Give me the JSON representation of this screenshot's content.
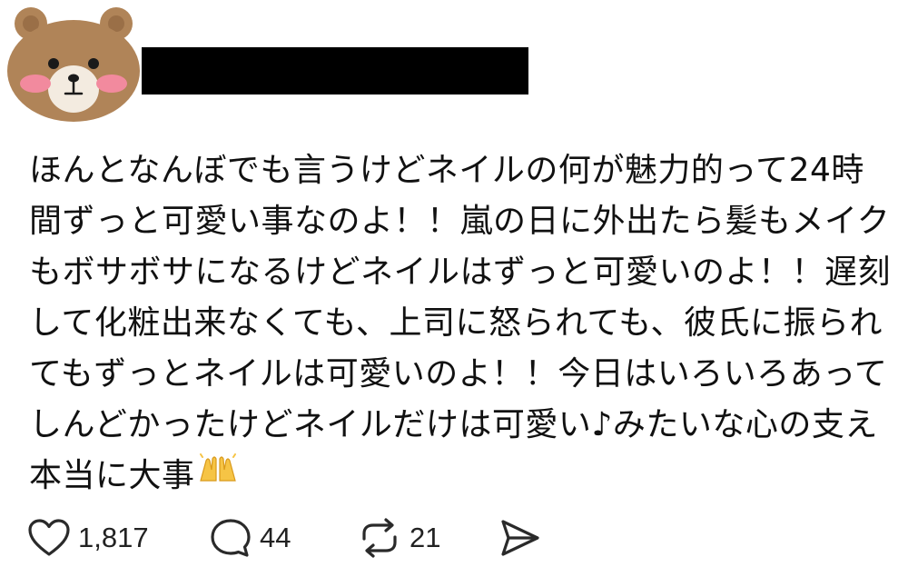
{
  "post": {
    "avatar_icon": "bear-avatar-icon",
    "text_lines": [
      "ほんとなんぼでも言うけどネイルの何が魅力的って24時",
      "間ずっと可愛い事なのよ！！嵐の日に外出たら髪もメイク",
      "もボサボサになるけどネイルはずっと可愛いのよ！！遅刻",
      "して化粧出来なくても、上司に怒られても、彼氏に振られ",
      "てもずっとネイルは可愛いのよ！！今日はいろいろあって",
      "しんどかったけどネイルだけは可愛い♪みたいな心の支え",
      "本当に大事"
    ],
    "trailing_emoji": "raising-hands-emoji-icon"
  },
  "actions": {
    "like": {
      "icon": "heart-icon",
      "count": "1,817"
    },
    "reply": {
      "icon": "comment-icon",
      "count": "44"
    },
    "repost": {
      "icon": "repost-icon",
      "count": "21"
    },
    "share": {
      "icon": "send-icon"
    }
  },
  "colors": {
    "bear_fur": "#b08458",
    "bear_face": "#f3ebe0",
    "cheek": "#f28a9e",
    "text": "#111111",
    "redaction": "#000000"
  }
}
